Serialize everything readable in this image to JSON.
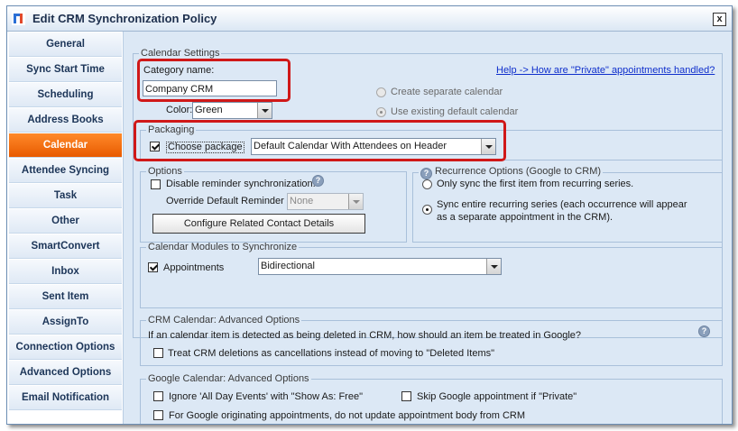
{
  "window": {
    "title": "Edit CRM Synchronization Policy",
    "close_label": "x"
  },
  "sidebar": {
    "items": [
      {
        "label": "General"
      },
      {
        "label": "Sync Start Time"
      },
      {
        "label": "Scheduling"
      },
      {
        "label": "Address Books"
      },
      {
        "label": "Calendar"
      },
      {
        "label": "Attendee Syncing"
      },
      {
        "label": "Task"
      },
      {
        "label": "Other"
      },
      {
        "label": "SmartConvert"
      },
      {
        "label": "Inbox"
      },
      {
        "label": "Sent Item"
      },
      {
        "label": "AssignTo"
      },
      {
        "label": "Connection Options"
      },
      {
        "label": "Advanced Options"
      },
      {
        "label": "Email Notification"
      }
    ],
    "active_index": 4
  },
  "calendar_settings": {
    "legend": "Calendar Settings",
    "category_label": "Category name:",
    "category_value": "Company CRM",
    "color_label": "Color:",
    "color_value": "Green",
    "help_link": "Help -> How are \"Private\" appointments handled?",
    "create_separate": "Create separate calendar",
    "use_existing": "Use existing default calendar"
  },
  "packaging": {
    "legend": "Packaging",
    "choose_label": "Choose package",
    "package_value": "Default Calendar With Attendees on Header"
  },
  "options": {
    "legend": "Options",
    "disable_reminder": "Disable reminder synchronization.",
    "override_label": "Override Default Reminder",
    "override_value": "None",
    "configure_button": "Configure Related Contact Details"
  },
  "recurrence": {
    "legend": "Recurrence Options (Google to CRM)",
    "only_first": "Only sync the first item from recurring series.",
    "sync_entire_line1": "Sync entire recurring series (each occurrence will appear",
    "sync_entire_line2": "as a separate appointment in the CRM)."
  },
  "modules": {
    "legend": "Calendar Modules to Synchronize",
    "appointments_label": "Appointments",
    "appointments_value": "Bidirectional"
  },
  "crm_advanced": {
    "legend": "CRM Calendar: Advanced Options",
    "question": "If an calendar item is detected as being deleted in CRM, how should an item be treated in Google?",
    "treat_deletions": "Treat CRM deletions as cancellations instead of moving to \"Deleted Items\""
  },
  "google_advanced": {
    "legend": "Google Calendar: Advanced Options",
    "ignore_all_day": "Ignore 'All Day Events' with \"Show As: Free\"",
    "skip_private": "Skip Google appointment if \"Private\"",
    "no_update_body": "For Google originating appointments, do not update appointment body from CRM"
  },
  "colors": {
    "active_tab": "#f07010",
    "highlight": "#d01818",
    "link": "#0f2fcc",
    "color_swatch": "#008000"
  }
}
